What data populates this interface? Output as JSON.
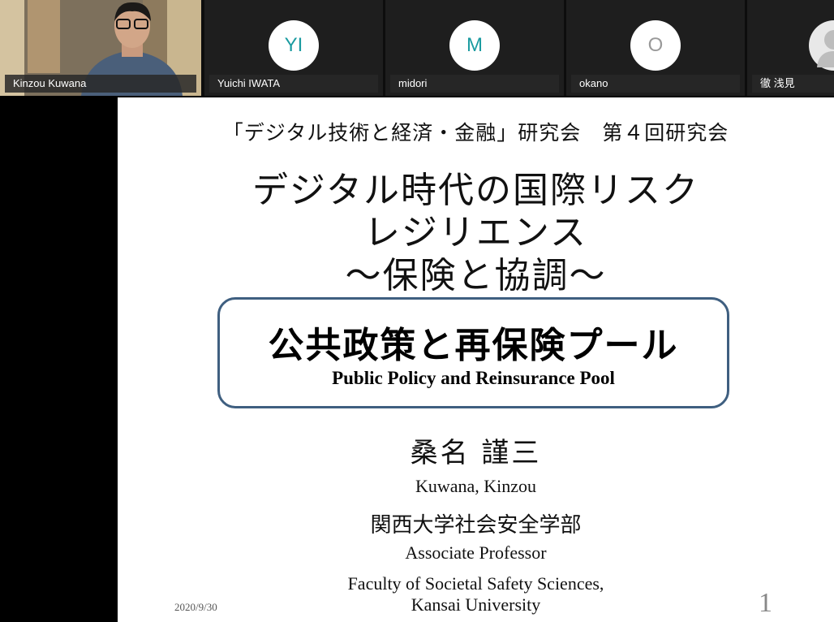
{
  "participants": [
    {
      "name": "Kinzou Kuwana",
      "initials": ""
    },
    {
      "name": "Yuichi IWATA",
      "initials": "YI"
    },
    {
      "name": "midori",
      "initials": "M"
    },
    {
      "name": "okano",
      "initials": "O"
    },
    {
      "name": "徹 浅見",
      "initials": ""
    }
  ],
  "colors": {
    "initials": "#1a9ba0",
    "slide_border": "#3f5f80"
  },
  "slide": {
    "series": "「デジタル技術と経済・金融」研究会　第４回研究会",
    "title_lines": [
      "デジタル時代の国際リスク",
      "レジリエンス",
      "〜保険と協調〜"
    ],
    "subtitle_jp": "公共政策と再保険プール",
    "subtitle_en": "Public Policy and Reinsurance Pool",
    "author_jp": "桑名 謹三",
    "author_en": "Kuwana, Kinzou",
    "affiliation_jp": "関西大学社会安全学部",
    "position_en": "Associate Professor",
    "faculty_en_1": "Faculty of Societal Safety Sciences,",
    "faculty_en_2": "Kansai University",
    "date": "2020/9/30",
    "page_number": "1"
  }
}
